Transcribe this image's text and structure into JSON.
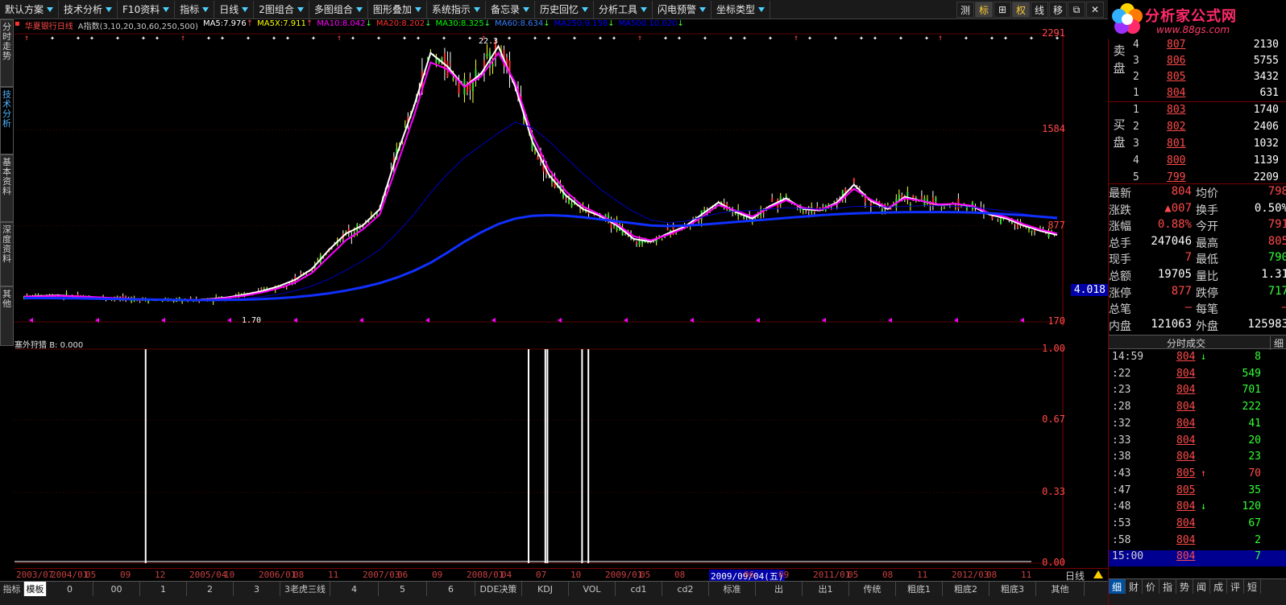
{
  "toolbar": {
    "items": [
      {
        "label": "默认方案"
      },
      {
        "label": "技术分析"
      },
      {
        "label": "F10资料"
      },
      {
        "label": "指标"
      },
      {
        "label": "日线"
      },
      {
        "label": "2图组合"
      },
      {
        "label": "多图组合"
      },
      {
        "label": "图形叠加"
      },
      {
        "label": "系统指示"
      },
      {
        "label": "备忘录"
      },
      {
        "label": "历史回忆"
      },
      {
        "label": "分析工具"
      },
      {
        "label": "闪电预警"
      },
      {
        "label": "坐标类型"
      }
    ],
    "right_buttons": [
      "测",
      "标",
      "⊞",
      "权",
      "线",
      "移",
      "⧉",
      "✕"
    ]
  },
  "logo": {
    "name": "分析家公式网",
    "url": "www.88gs.com"
  },
  "left_tabs": [
    "分时走势",
    "技术分析",
    "基本资料",
    "深度资料",
    "其他"
  ],
  "chart_header": {
    "stock": "华夏银行日线",
    "indicator": "A指数(3,10,20,30,60,250,500)",
    "ma_values": [
      {
        "label": "MA5:",
        "value": "7.976",
        "dir": "↑",
        "color": "#ffffff"
      },
      {
        "label": "MA5X:",
        "value": "7.911",
        "dir": "↑",
        "color": "#ffff00"
      },
      {
        "label": "MA10:",
        "value": "8.042",
        "dir": "↓",
        "color": "#ff00ff"
      },
      {
        "label": "MA20:",
        "value": "8.202",
        "dir": "↓",
        "color": "#ff3030"
      },
      {
        "label": "MA30:",
        "value": "8.325",
        "dir": "↓",
        "color": "#00ff00"
      },
      {
        "label": "MA60:",
        "value": "8.634",
        "dir": "↓",
        "color": "#3a7dff"
      },
      {
        "label": "MA250:",
        "value": "9.158",
        "dir": "↓",
        "color": "#0000ff"
      },
      {
        "label": "MA500:",
        "value": "10.020",
        "dir": "↓",
        "color": "#0000ff"
      }
    ]
  },
  "chart_labels": {
    "high": "22.3",
    "low": "1.70",
    "current": "4.018"
  },
  "chart_data": [
    {
      "type": "line",
      "title": "华夏银行日线",
      "ylim": [
        170,
        2291
      ],
      "y_ticks": [
        "2291",
        "1584",
        "877",
        "170"
      ],
      "series": [
        {
          "name": "MA5",
          "color": "#ffffff",
          "values": [
            355,
            360,
            365,
            358,
            352,
            345,
            340,
            335,
            330,
            328,
            330,
            338,
            350,
            370,
            395,
            430,
            480,
            560,
            700,
            820,
            880,
            1000,
            1400,
            1750,
            2150,
            2050,
            1900,
            2000,
            2200,
            1900,
            1500,
            1250,
            1100,
            1000,
            950,
            880,
            780,
            760,
            820,
            870,
            960,
            1050,
            980,
            930,
            1020,
            1080,
            1000,
            990,
            1050,
            1180,
            1060,
            1000,
            1090,
            1060,
            1030,
            1040,
            1020,
            960,
            930,
            880,
            840,
            810
          ]
        },
        {
          "name": "MA10",
          "color": "#ff00ff",
          "values": [
            355,
            358,
            362,
            358,
            353,
            347,
            342,
            337,
            332,
            330,
            331,
            336,
            346,
            362,
            385,
            415,
            460,
            530,
            650,
            770,
            850,
            960,
            1320,
            1680,
            2080,
            2030,
            1900,
            1980,
            2150,
            1930,
            1550,
            1290,
            1130,
            1020,
            960,
            890,
            800,
            770,
            810,
            860,
            940,
            1030,
            990,
            945,
            1010,
            1065,
            1010,
            995,
            1040,
            1150,
            1070,
            1010,
            1080,
            1060,
            1035,
            1040,
            1025,
            970,
            940,
            890,
            850,
            820
          ]
        },
        {
          "name": "MA60",
          "color": "#0000c0",
          "values": [
            350,
            350,
            349,
            347,
            344,
            341,
            338,
            335,
            332,
            330,
            329,
            330,
            334,
            342,
            354,
            372,
            398,
            434,
            485,
            550,
            620,
            700,
            820,
            960,
            1120,
            1260,
            1380,
            1470,
            1560,
            1640,
            1600,
            1500,
            1380,
            1260,
            1150,
            1060,
            980,
            920,
            900,
            910,
            940,
            970,
            985,
            990,
            1000,
            1010,
            1005,
            1000,
            1005,
            1020,
            1020,
            1015,
            1020,
            1025,
            1025,
            1020,
            1015,
            1000,
            985,
            965,
            945,
            925
          ]
        },
        {
          "name": "MA250",
          "color": "#1030ff",
          "values": [
            345,
            345,
            344,
            343,
            341,
            339,
            337,
            335,
            333,
            331,
            330,
            330,
            331,
            333,
            337,
            343,
            352,
            364,
            380,
            400,
            425,
            455,
            495,
            545,
            605,
            680,
            760,
            830,
            890,
            930,
            950,
            955,
            950,
            940,
            925,
            910,
            895,
            880,
            875,
            878,
            885,
            895,
            905,
            915,
            925,
            935,
            945,
            955,
            962,
            968,
            972,
            975,
            977,
            978,
            978,
            977,
            975,
            970,
            963,
            955,
            945,
            935
          ]
        }
      ]
    },
    {
      "type": "bar",
      "title": "塞外狩猎",
      "ylim": [
        0,
        1
      ],
      "y_ticks": [
        "1.00",
        "0.67",
        "0.33",
        "0.00"
      ],
      "legend_label": "B: 0.000",
      "signal_positions": [
        0.125,
        0.49,
        0.506,
        0.508,
        0.541,
        0.547
      ],
      "signal_values": [
        1,
        1,
        1,
        1,
        1,
        1
      ]
    }
  ],
  "date_axis": {
    "labels": [
      "2003/07",
      "2004/01",
      "05",
      "09",
      "12",
      "2005/04",
      "10",
      "2006/01",
      "08",
      "11",
      "2007/03",
      "06",
      "09",
      "2008/01",
      "04",
      "07",
      "10",
      "2009/01",
      "05",
      "08",
      "2009/09/04(五)",
      "06",
      "09",
      "2011/01",
      "05",
      "08",
      "11",
      "2012/03",
      "08",
      "11"
    ],
    "cursor_date": "2009/09/04(五)"
  },
  "bottom_tabs": [
    "指标",
    "模板",
    "0",
    "00",
    "1",
    "2",
    "3",
    "3老虎三线",
    "4",
    "5",
    "6",
    "DDE决策",
    "KDJ",
    "VOL",
    "cd1",
    "cd2",
    "标准",
    "出",
    "出1",
    "传统",
    "粗底1",
    "粗底2",
    "粗底3",
    "其他"
  ],
  "period_label": "日线",
  "order_book": {
    "sell_label": "卖盘",
    "buy_label": "买盘",
    "sell": [
      {
        "level": "4",
        "price": "807",
        "vol": "2130"
      },
      {
        "level": "3",
        "price": "806",
        "vol": "5755"
      },
      {
        "level": "2",
        "price": "805",
        "vol": "3432"
      },
      {
        "level": "1",
        "price": "804",
        "vol": "631"
      }
    ],
    "buy": [
      {
        "level": "1",
        "price": "803",
        "vol": "1740"
      },
      {
        "level": "2",
        "price": "802",
        "vol": "2406"
      },
      {
        "level": "3",
        "price": "801",
        "vol": "1032"
      },
      {
        "level": "4",
        "price": "800",
        "vol": "1139"
      },
      {
        "level": "5",
        "price": "799",
        "vol": "2209"
      }
    ]
  },
  "quote": [
    {
      "l": "最新",
      "v": "804",
      "l2": "均价",
      "v2": "798"
    },
    {
      "l": "涨跌",
      "v": "▲007",
      "l2": "换手",
      "v2": "0.50%"
    },
    {
      "l": "涨幅",
      "v": "0.88%",
      "l2": "今开",
      "v2": "791"
    },
    {
      "l": "总手",
      "v": "247046",
      "l2": "最高",
      "v2": "805"
    },
    {
      "l": "现手",
      "v": "7",
      "l2": "最低",
      "v2": "790"
    },
    {
      "l": "总额",
      "v": "19705",
      "l2": "量比",
      "v2": "1.31"
    },
    {
      "l": "涨停",
      "v": "877",
      "l2": "跌停",
      "v2": "717"
    },
    {
      "l": "总笔",
      "v": "–",
      "l2": "每笔",
      "v2": "–"
    },
    {
      "l": "内盘",
      "v": "121063",
      "l2": "外盘",
      "v2": "125983"
    }
  ],
  "trade_header": {
    "title": "分时成交",
    "detail": "细"
  },
  "trades": [
    {
      "t": "14:59",
      "p": "804",
      "a": "↓",
      "q": "8",
      "qc": "#33ff33"
    },
    {
      "t": ":22",
      "p": "804",
      "a": "",
      "q": "549",
      "qc": "#33ff33"
    },
    {
      "t": ":23",
      "p": "804",
      "a": "",
      "q": "701",
      "qc": "#33ff33"
    },
    {
      "t": ":28",
      "p": "804",
      "a": "",
      "q": "222",
      "qc": "#33ff33"
    },
    {
      "t": ":32",
      "p": "804",
      "a": "",
      "q": "41",
      "qc": "#33ff33"
    },
    {
      "t": ":33",
      "p": "804",
      "a": "",
      "q": "20",
      "qc": "#33ff33"
    },
    {
      "t": ":38",
      "p": "804",
      "a": "",
      "q": "23",
      "qc": "#33ff33"
    },
    {
      "t": ":43",
      "p": "805",
      "a": "↑",
      "q": "70",
      "qc": "#ff4a4a"
    },
    {
      "t": ":47",
      "p": "805",
      "a": "",
      "q": "35",
      "qc": "#33ff33"
    },
    {
      "t": ":48",
      "p": "804",
      "a": "↓",
      "q": "120",
      "qc": "#33ff33"
    },
    {
      "t": ":53",
      "p": "804",
      "a": "",
      "q": "67",
      "qc": "#33ff33"
    },
    {
      "t": ":58",
      "p": "804",
      "a": "",
      "q": "2",
      "qc": "#33ff33"
    },
    {
      "t": "15:00",
      "p": "804",
      "a": "",
      "q": "7",
      "qc": "#33ff33"
    }
  ],
  "panel_tabs": [
    "细",
    "财",
    "价",
    "指",
    "势",
    "闻",
    "成",
    "评",
    "短"
  ]
}
